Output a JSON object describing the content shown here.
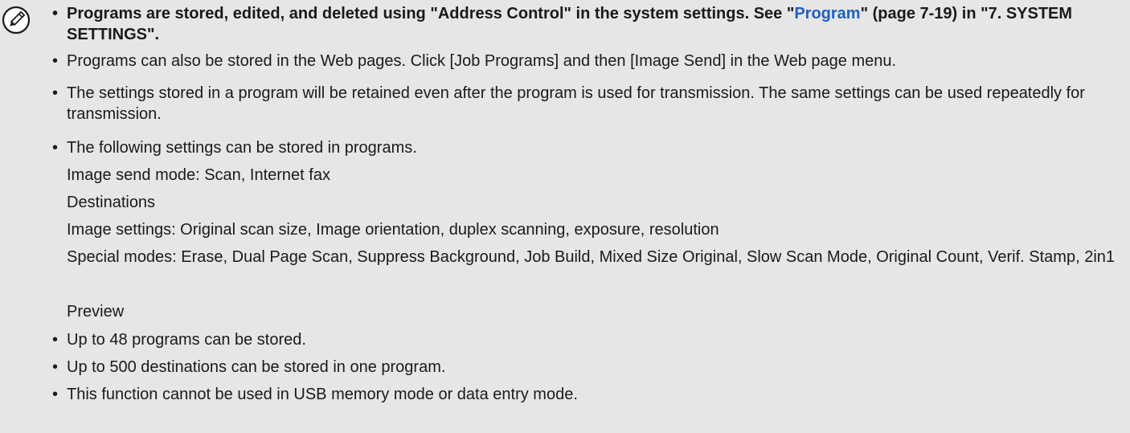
{
  "note": {
    "icon": "pencil-note-icon",
    "items": [
      {
        "bold_prefix": "Programs are stored, edited, and deleted using \"Address Control\" in the system settings. See \"",
        "link_text": "Program",
        "bold_suffix": "\" (page 7-19) in \"7. SYSTEM SETTINGS\"."
      },
      {
        "text": "Programs can also be stored in the Web pages. Click [Job Programs] and then [Image Send] in the Web page menu."
      },
      {
        "text": "The settings stored in a program will be retained even after the program is used for transmission. The same settings can be used repeatedly for transmission."
      },
      {
        "text": "The following settings can be stored in programs."
      },
      {
        "text": "Up to 48 programs can be stored."
      },
      {
        "text": "Up to 500 destinations can be stored in one program."
      },
      {
        "text": "This function cannot be used in USB memory mode or data entry mode."
      }
    ],
    "sub_items": {
      "image_send_mode": "Image send mode: Scan, Internet fax",
      "destinations": "Destinations",
      "image_settings": "Image settings: Original scan size, Image orientation, duplex scanning, exposure, resolution",
      "special_modes_label": "Special modes: ",
      "special_modes_text": "Erase, Dual Page Scan, Suppress Background, Job Build, Mixed Size Original, Slow Scan Mode, Original Count, Verif. Stamp, 2in1",
      "preview": "Preview"
    },
    "bullet_char": "•"
  }
}
